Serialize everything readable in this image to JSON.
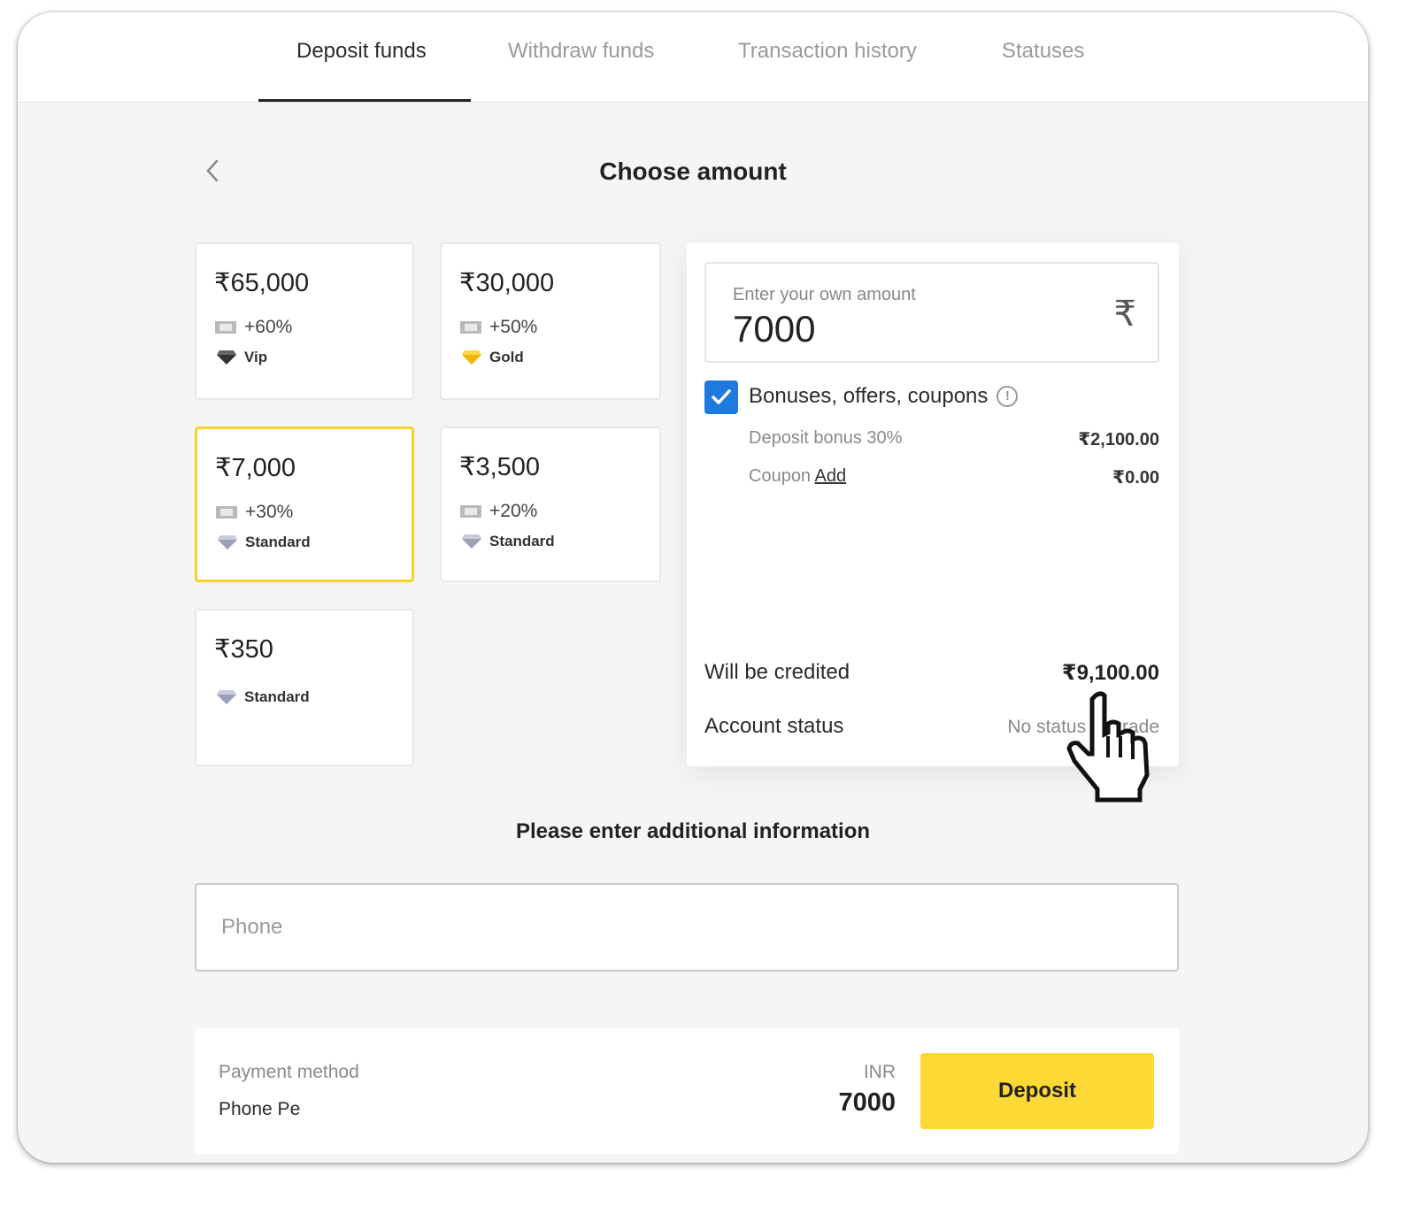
{
  "tabs": [
    {
      "label": "Deposit funds",
      "active": true
    },
    {
      "label": "Withdraw funds",
      "active": false
    },
    {
      "label": "Transaction history",
      "active": false
    },
    {
      "label": "Statuses",
      "active": false
    }
  ],
  "page": {
    "title": "Choose amount"
  },
  "cards": [
    {
      "amount": "₹65,000",
      "bonus": "+60%",
      "level": "Vip",
      "gem": "vip-gem-icon"
    },
    {
      "amount": "₹30,000",
      "bonus": "+50%",
      "level": "Gold",
      "gem": "gold-gem-icon"
    },
    {
      "amount": "₹7,000",
      "bonus": "+30%",
      "level": "Standard",
      "gem": "standard-gem-icon",
      "selected": true
    },
    {
      "amount": "₹3,500",
      "bonus": "+20%",
      "level": "Standard",
      "gem": "standard-gem-icon"
    },
    {
      "amount": "₹350",
      "bonus": "",
      "level": "Standard",
      "gem": "standard-gem-icon"
    }
  ],
  "summary": {
    "amount_label": "Enter your own amount",
    "amount_value": "7000",
    "currency_symbol": "₹",
    "bonus_checked": true,
    "bonus_title": "Bonuses, offers, coupons",
    "deposit_bonus_label": "Deposit bonus 30%",
    "deposit_bonus_value": "₹2,100.00",
    "coupon_label": "Coupon",
    "coupon_link": "Add",
    "coupon_value": "₹0.00",
    "credited_label": "Will be credited",
    "credited_value": "₹9,100.00",
    "status_label": "Account status",
    "status_value": "No status upgrade"
  },
  "additional": {
    "title": "Please enter additional information",
    "phone_placeholder": "Phone"
  },
  "payment": {
    "method_label": "Payment method",
    "method_value": "Phone Pe",
    "currency": "INR",
    "amount": "7000",
    "deposit_label": "Deposit"
  },
  "colors": {
    "accent_yellow": "#fcd935",
    "checkbox_blue": "#1f7ae0",
    "selected_border": "#f5d42a"
  }
}
